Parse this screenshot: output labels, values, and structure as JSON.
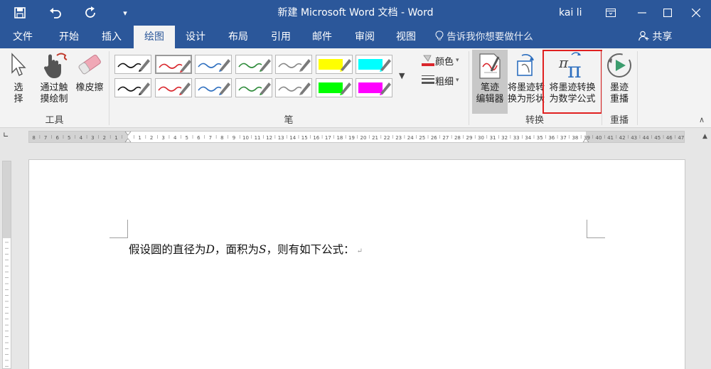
{
  "window": {
    "title": "新建 Microsoft Word 文档  -  Word",
    "user": "kai li"
  },
  "quick_access": {
    "save_icon": "save-icon",
    "undo_icon": "undo-icon",
    "redo_icon": "redo-icon",
    "customize_icon": "customize-icon"
  },
  "tabs": [
    {
      "label": "文件"
    },
    {
      "label": "开始"
    },
    {
      "label": "插入"
    },
    {
      "label": "绘图",
      "active": true
    },
    {
      "label": "设计"
    },
    {
      "label": "布局"
    },
    {
      "label": "引用"
    },
    {
      "label": "邮件"
    },
    {
      "label": "审阅"
    },
    {
      "label": "视图"
    }
  ],
  "tell_me": "告诉我你想要做什么",
  "share": "共享",
  "ribbon": {
    "tools": {
      "label": "工具",
      "select": "选\n择",
      "touch_draw": "通过触\n摸绘制",
      "eraser": "橡皮擦"
    },
    "pens": {
      "label": "笔",
      "colors": [
        "#111111",
        "#d9262c",
        "#2e6fbf",
        "#2e8b3a",
        "#888888",
        "#ffff00",
        "#00ffff",
        "#111111",
        "#d9262c",
        "#2e6fbf",
        "#2e8b3a",
        "#888888",
        "#00ff00",
        "#ff00ff"
      ],
      "selected_index": 1,
      "color_label": "颜色",
      "thickness_label": "粗细"
    },
    "convert": {
      "label": "转换",
      "ink_editor": "笔迹\n编辑器",
      "ink_to_shape": "将墨迹转\n换为形状",
      "ink_to_math": "将墨迹转换\n为数学公式"
    },
    "replay": {
      "label": "重播",
      "ink_replay": "墨迹\n重播"
    }
  },
  "document": {
    "text_prefix": "假设圆的直径为",
    "var_d": "D",
    "text_mid": "，面积为",
    "var_s": "S",
    "text_suffix": "，则有如下公式：",
    "para_mark": "↵"
  },
  "ruler": {
    "left_numbers": [
      "8",
      "7",
      "6",
      "5",
      "4",
      "3",
      "2",
      "1"
    ],
    "main_numbers": [
      "1",
      "2",
      "3",
      "4",
      "5",
      "6",
      "7",
      "8",
      "9",
      "10",
      "11",
      "12",
      "13",
      "14",
      "15",
      "16",
      "17",
      "18",
      "19",
      "20",
      "21",
      "22",
      "23",
      "24",
      "25",
      "26",
      "27",
      "28",
      "29",
      "30",
      "31",
      "32",
      "33",
      "34",
      "35",
      "36",
      "37",
      "38",
      "39"
    ],
    "right_numbers": [
      "40",
      "41",
      "42",
      "43",
      "44",
      "45",
      "46",
      "47",
      "48"
    ]
  }
}
